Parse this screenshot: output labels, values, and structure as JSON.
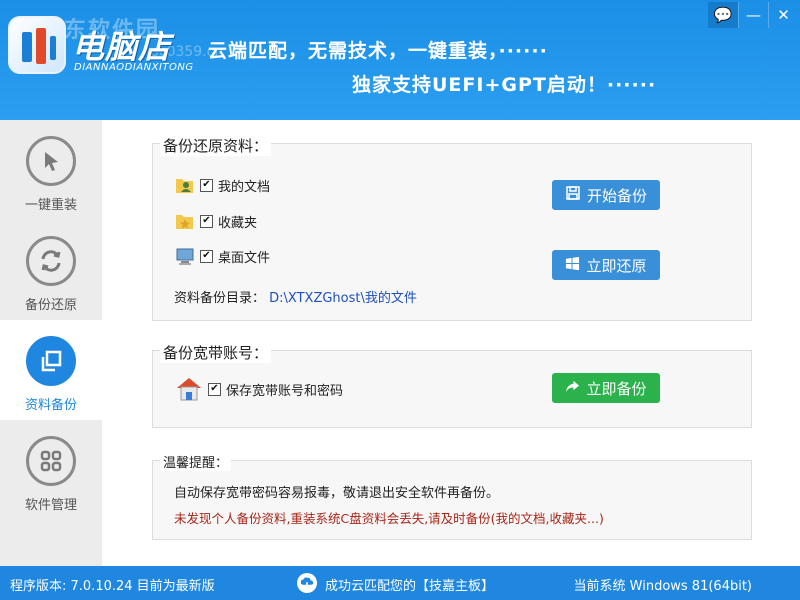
{
  "header": {
    "watermark": "河东软件园",
    "watermark_url": "pc0359.cn",
    "logo_title": "电脑店",
    "logo_sub": "DIANNAODIANXITONG",
    "slogan_line1": "云端匹配，无需技术，一键重装，······",
    "slogan_line2": "独家支持UEFI+GPT启动！······",
    "window_controls": [
      "💬",
      "—",
      "✕"
    ]
  },
  "sidebar": {
    "items": [
      {
        "label": "一键重装",
        "icon": "cursor-icon",
        "active": false
      },
      {
        "label": "备份还原",
        "icon": "refresh-icon",
        "active": false
      },
      {
        "label": "资料备份",
        "icon": "copy-icon",
        "active": true
      },
      {
        "label": "软件管理",
        "icon": "grid-icon",
        "active": false
      }
    ]
  },
  "backup_restore": {
    "title": "备份还原资料：",
    "items": [
      {
        "label": "我的文档",
        "checked": true
      },
      {
        "label": "收藏夹",
        "checked": true
      },
      {
        "label": "桌面文件",
        "checked": true
      }
    ],
    "start_backup_label": "开始备份",
    "restore_label": "立即还原",
    "dir_label": "资料备份目录：",
    "dir_path": "D:\\XTXZGhost\\我的文件"
  },
  "broadband": {
    "title": "备份宽带账号：",
    "item_label": "保存宽带账号和密码",
    "checked": true,
    "backup_label": "立即备份"
  },
  "tips": {
    "title": "温馨提醒：",
    "line1": "自动保存宽带密码容易报毒，敬请退出安全软件再备份。",
    "line2": "未发现个人备份资料,重装系统C盘资料会丢失,请及时备份(我的文档,收藏夹...)"
  },
  "statusbar": {
    "version": "程序版本: 7.0.10.24 目前为最新版",
    "match_msg": "成功云匹配您的【技嘉主板】",
    "system": "当前系统 Windows 81(64bit)"
  },
  "colors": {
    "header_blue": "#1b8fe6",
    "accent_blue": "#1f87e0",
    "button_blue": "#3a8fd9",
    "button_green": "#2bb24c",
    "warning_red": "#a8261a"
  }
}
